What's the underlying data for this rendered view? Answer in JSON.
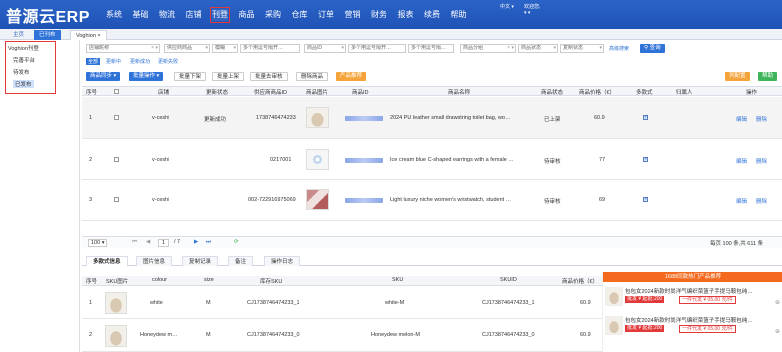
{
  "app": {
    "logo": "普源云ERP"
  },
  "main_menu": [
    "系统",
    "基础",
    "物流",
    "店铺",
    "刊登",
    "商品",
    "采购",
    "仓库",
    "订单",
    "营销",
    "财务",
    "报表",
    "续费",
    "帮助"
  ],
  "main_menu_active": "刊登",
  "user": {
    "lang": "中文 ▾",
    "welcome": "欢迎您,",
    "name": "▾ ▾"
  },
  "page_tabs": [
    "主页",
    "已刊布",
    "Voghion ×"
  ],
  "tree": {
    "root": "Voghion刊登",
    "items": [
      "完善平台",
      "待发布",
      "已发布"
    ],
    "selected": "已发布"
  },
  "filters": {
    "store": "店铺昵称",
    "supplier_code": "供应商商品",
    "fuzzy": "模糊",
    "multi1": "多个用逗号隔开…",
    "product_id": "商品ID",
    "multi2": "多个用逗号隔开…",
    "multi3": "多个用逗号隔…",
    "category": "商品分组",
    "status": "商品状态",
    "copy_status": "复制状态",
    "advanced": "高级搜索",
    "search": "查询"
  },
  "toolbar": {
    "sync": "商品同步 ▾",
    "batch": "批量操作 ▾",
    "batch_off": "批量下架",
    "batch_on": "批量上架",
    "batch_review": "批量去审核",
    "delete": "删除商品",
    "product_listing": "产品推荐",
    "col_setting": "列配置",
    "help": "帮助"
  },
  "subfilters": [
    "全部",
    "更新中",
    "更新成功",
    "更新失败"
  ],
  "grid_headers": [
    "序号",
    "",
    "店铺",
    "更新状态",
    "供应商商品ID",
    "商品图片",
    "商品ID",
    "商品名称",
    "商品状态",
    "商品价格（€）",
    "多款式",
    "归属人",
    "操作"
  ],
  "grid_rows": [
    {
      "no": "1",
      "store": "v-ceshi",
      "update_status": "更新成功",
      "supplier_id": "1738746474233",
      "name": "2024 PU leather small drawstring toilet bag, wo…",
      "status": "已上架",
      "price": "60.9",
      "multi": true,
      "thumb": "bag",
      "edit": "编辑",
      "delete": "删除"
    },
    {
      "no": "2",
      "store": "v-ceshi",
      "update_status": "",
      "supplier_id": "0217001",
      "name": "Ice cream blue C-shaped earrings with a female …",
      "status": "待审核",
      "price": "77",
      "multi": true,
      "thumb": "ring",
      "edit": "编辑",
      "delete": "删除"
    },
    {
      "no": "3",
      "store": "v-ceshi",
      "update_status": "",
      "supplier_id": "002-722916975069",
      "name": "Light luxury niche women's wristwatch, student …",
      "status": "待审核",
      "price": "69",
      "multi": true,
      "thumb": "watch",
      "edit": "编辑",
      "delete": "删除"
    }
  ],
  "pager": {
    "size": "100 ▾",
    "page": "1",
    "total_pages": "/ 7",
    "summary": "每页 100 条,共 611 条"
  },
  "sub_tabs": [
    "多款式信息",
    "图片信息",
    "复制记录",
    "备注",
    "操作日志"
  ],
  "sub_headers": [
    "序号",
    "SKU图片",
    "colour",
    "size",
    "库存SKU",
    "SKU",
    "SKUID",
    "商品价格（€）"
  ],
  "sub_rows": [
    {
      "no": "1",
      "colour": "white",
      "size": "M",
      "stock_sku": "CJ1738746474233_1",
      "sku": "white-M",
      "skuid": "CJ1738746474233_1",
      "price": "60.9"
    },
    {
      "no": "2",
      "colour": "Honeydew m…",
      "size": "M",
      "stock_sku": "CJ1738746474233_0",
      "sku": "Honeydew melon-M",
      "skuid": "CJ1738746474233_0",
      "price": "60.9"
    }
  ],
  "ad": {
    "header": "1688同款热门产品推荐",
    "items": [
      {
        "title": "包包女2024新款时尚洋气编织菜篮子手提马鞍包纯…",
        "price": "批发 ¥ 起批:200",
        "retail": "一件代发 ¥ 05.00 元/件"
      },
      {
        "title": "包包女2024新款时尚洋气编织菜篮子手提马鞍包纯…",
        "price": "批发 ¥ 起批:200",
        "retail": "一件代发 ¥ 05.00 元/件"
      }
    ]
  },
  "colors": {
    "topbar": "#1f52b5",
    "accent": "#2f73d9",
    "highlight_box": "#e23a3a",
    "ad_header": "#f36a1f"
  }
}
